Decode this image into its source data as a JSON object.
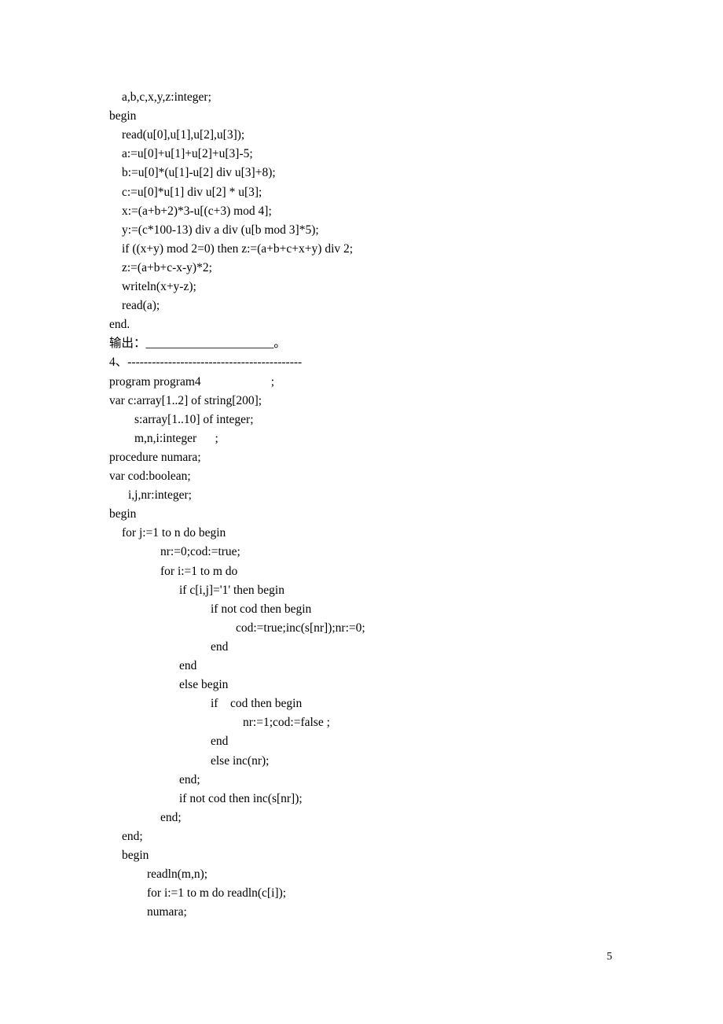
{
  "document": {
    "lines": [
      {
        "indent": 1,
        "text": "a,b,c,x,y,z:integer;"
      },
      {
        "indent": 0,
        "text": "begin"
      },
      {
        "indent": 1,
        "text": "read(u[0],u[1],u[2],u[3]);"
      },
      {
        "indent": 1,
        "text": "a:=u[0]+u[1]+u[2]+u[3]-5;"
      },
      {
        "indent": 1,
        "text": "b:=u[0]*(u[1]-u[2] div u[3]+8);"
      },
      {
        "indent": 1,
        "text": "c:=u[0]*u[1] div u[2] * u[3];"
      },
      {
        "indent": 1,
        "text": "x:=(a+b+2)*3-u[(c+3) mod 4];"
      },
      {
        "indent": 1,
        "text": "y:=(c*100-13) div a div (u[b mod 3]*5);"
      },
      {
        "indent": 1,
        "text": "if ((x+y) mod 2=0) then z:=(a+b+c+x+y) div 2;"
      },
      {
        "indent": 1,
        "text": "z:=(a+b+c-x-y)*2;"
      },
      {
        "indent": 1,
        "text": "writeln(x+y-z);"
      },
      {
        "indent": 1,
        "text": "read(a);"
      },
      {
        "indent": 0,
        "text": "end."
      },
      {
        "indent": 0,
        "text": "输出：_____________________。"
      },
      {
        "indent": 0,
        "text": "4、-------------------------------------------"
      },
      {
        "indent": 0,
        "text": "program program4                       ;"
      },
      {
        "indent": 0,
        "text": "var c:array[1..2] of string[200];"
      },
      {
        "indent": 2,
        "text": "s:array[1..10] of integer;"
      },
      {
        "indent": 2,
        "text": "m,n,i:integer      ;"
      },
      {
        "indent": 0,
        "text": "procedure numara;"
      },
      {
        "indent": 0,
        "text": "var cod:boolean;"
      },
      {
        "indent": 3,
        "text": "i,j,nr:integer;"
      },
      {
        "indent": 0,
        "text": "begin"
      },
      {
        "indent": 1,
        "text": "for j:=1 to n do begin"
      },
      {
        "indent": 4,
        "text": "nr:=0;cod:=true;"
      },
      {
        "indent": 4,
        "text": "for i:=1 to m do"
      },
      {
        "indent": 5,
        "text": "if c[i,j]='1' then begin"
      },
      {
        "indent": 6,
        "text": "if not cod then begin"
      },
      {
        "indent": 7,
        "text": "cod:=true;inc(s[nr]);nr:=0;"
      },
      {
        "indent": 6,
        "text": "end"
      },
      {
        "indent": 5,
        "text": "end"
      },
      {
        "indent": 5,
        "text": "else begin"
      },
      {
        "indent": 6,
        "text": "if    cod then begin"
      },
      {
        "indent": 8,
        "text": "nr:=1;cod:=false ;"
      },
      {
        "indent": 6,
        "text": "end"
      },
      {
        "indent": 6,
        "text": "else inc(nr);"
      },
      {
        "indent": 5,
        "text": "end;"
      },
      {
        "indent": 5,
        "text": "if not cod then inc(s[nr]);"
      },
      {
        "indent": 4,
        "text": "end;"
      },
      {
        "indent": 1,
        "text": "end;"
      },
      {
        "indent": 1,
        "text": "begin"
      },
      {
        "indent": 9,
        "text": "readln(m,n);"
      },
      {
        "indent": 9,
        "text": "for i:=1 to m do readln(c[i]);"
      },
      {
        "indent": 9,
        "text": "numara;"
      }
    ]
  },
  "footer": {
    "page_number": "5"
  }
}
